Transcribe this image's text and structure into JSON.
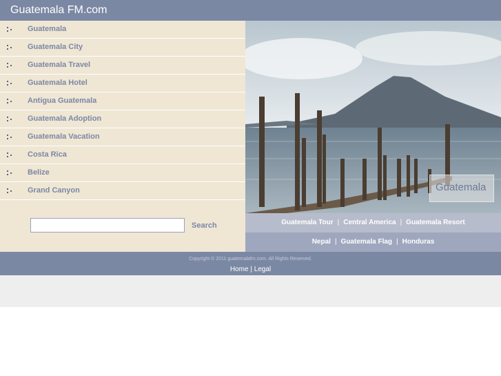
{
  "header": {
    "title": "Guatemala FM.com"
  },
  "nav": [
    {
      "label": "Guatemala"
    },
    {
      "label": "Guatemala City"
    },
    {
      "label": "Guatemala Travel"
    },
    {
      "label": "Guatemala Hotel"
    },
    {
      "label": "Antigua Guatemala"
    },
    {
      "label": "Guatemala Adoption"
    },
    {
      "label": "Guatemala Vacation"
    },
    {
      "label": "Costa Rica"
    },
    {
      "label": "Belize"
    },
    {
      "label": "Grand Canyon"
    }
  ],
  "search": {
    "value": "",
    "button_label": "Search"
  },
  "photo": {
    "caption": "Guatemala"
  },
  "links_row1": [
    "Guatemala Tour",
    "Central America",
    "Guatemala Resort"
  ],
  "links_row2": [
    "Nepal",
    "Guatemala Flag",
    "Honduras"
  ],
  "separator": "|",
  "footer": {
    "copyright": "Copyright © 2011 guatemalafm.com. All Rights Reserved.",
    "links": [
      "Home",
      "Legal"
    ],
    "links_separator": "|"
  },
  "colors": {
    "header_bg": "#7b88a4",
    "sidebar_bg": "#efe6d4",
    "link_text": "#7b88a4",
    "links_row1_bg": "#b7bccc",
    "links_row2_bg": "#9ea7bd"
  }
}
